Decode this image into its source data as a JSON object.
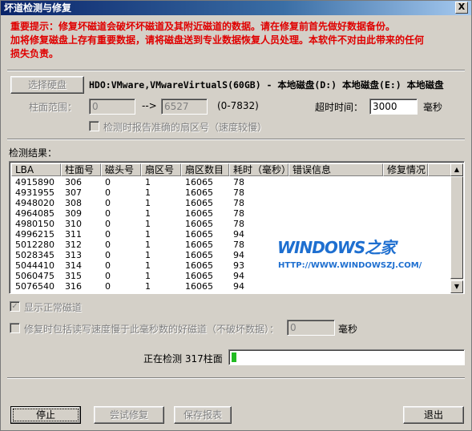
{
  "window": {
    "title": "坏道检测与修复",
    "close_glyph": "X"
  },
  "warning": {
    "line1": "重要提示：修复坏磁道会破坏坏磁道及其附近磁道的数据。请在修复前首先做好数据备份。",
    "line2": "加将修复磁盘上存有重要数据，请将磁盘送到专业数据恢复人员处理。本软件不对由此带来的任何",
    "line3": "损失负责。"
  },
  "disk": {
    "select_button": "选择硬盘",
    "display": "HDO:VMware,VMwareVirtualS(60GB) - 本地磁盘(D:) 本地磁盘(E:) 本地磁盘"
  },
  "range": {
    "label": "柱面范围：",
    "from": "0",
    "arrow": "-->",
    "to": "6527",
    "limits": "(0-7832)"
  },
  "timeout": {
    "label": "超时时间：",
    "value": "3000",
    "unit": "毫秒"
  },
  "options": {
    "report_sector": "检测时报告准确的扇区号（速度较慢）",
    "show_normal": "显示正常磁道",
    "repair_slow": "修复时包括读写速度慢于此毫秒数的好磁道（不破坏数据）：",
    "repair_slow_value": "0",
    "repair_slow_unit": "毫秒"
  },
  "results": {
    "label": "检测结果：",
    "columns": [
      "LBA",
      "柱面号",
      "磁头号",
      "扇区号",
      "扇区数目",
      "耗时（毫秒）",
      "错误信息",
      "修复情况"
    ],
    "rows": [
      [
        "4915890",
        "306",
        "0",
        "1",
        "16065",
        "78",
        "",
        ""
      ],
      [
        "4931955",
        "307",
        "0",
        "1",
        "16065",
        "78",
        "",
        ""
      ],
      [
        "4948020",
        "308",
        "0",
        "1",
        "16065",
        "78",
        "",
        ""
      ],
      [
        "4964085",
        "309",
        "0",
        "1",
        "16065",
        "78",
        "",
        ""
      ],
      [
        "4980150",
        "310",
        "0",
        "1",
        "16065",
        "78",
        "",
        ""
      ],
      [
        "4996215",
        "311",
        "0",
        "1",
        "16065",
        "94",
        "",
        ""
      ],
      [
        "5012280",
        "312",
        "0",
        "1",
        "16065",
        "78",
        "",
        ""
      ],
      [
        "5028345",
        "313",
        "0",
        "1",
        "16065",
        "94",
        "",
        ""
      ],
      [
        "5044410",
        "314",
        "0",
        "1",
        "16065",
        "93",
        "",
        ""
      ],
      [
        "5060475",
        "315",
        "0",
        "1",
        "16065",
        "94",
        "",
        ""
      ],
      [
        "5076540",
        "316",
        "0",
        "1",
        "16065",
        "94",
        "",
        ""
      ]
    ]
  },
  "watermark": {
    "logo": "WINDOWS之家",
    "url": "HTTP://WWW.WINDOWSZJ.COM/"
  },
  "status": {
    "text": "正在检测 317柱面",
    "progress": 0.02
  },
  "buttons": {
    "stop": "停止",
    "try_repair": "尝试修复",
    "save_report": "保存报表",
    "exit": "退出"
  },
  "colors": {
    "warning": "#e00000",
    "progress": "#22bb22",
    "title_bar": "#0a246a"
  }
}
